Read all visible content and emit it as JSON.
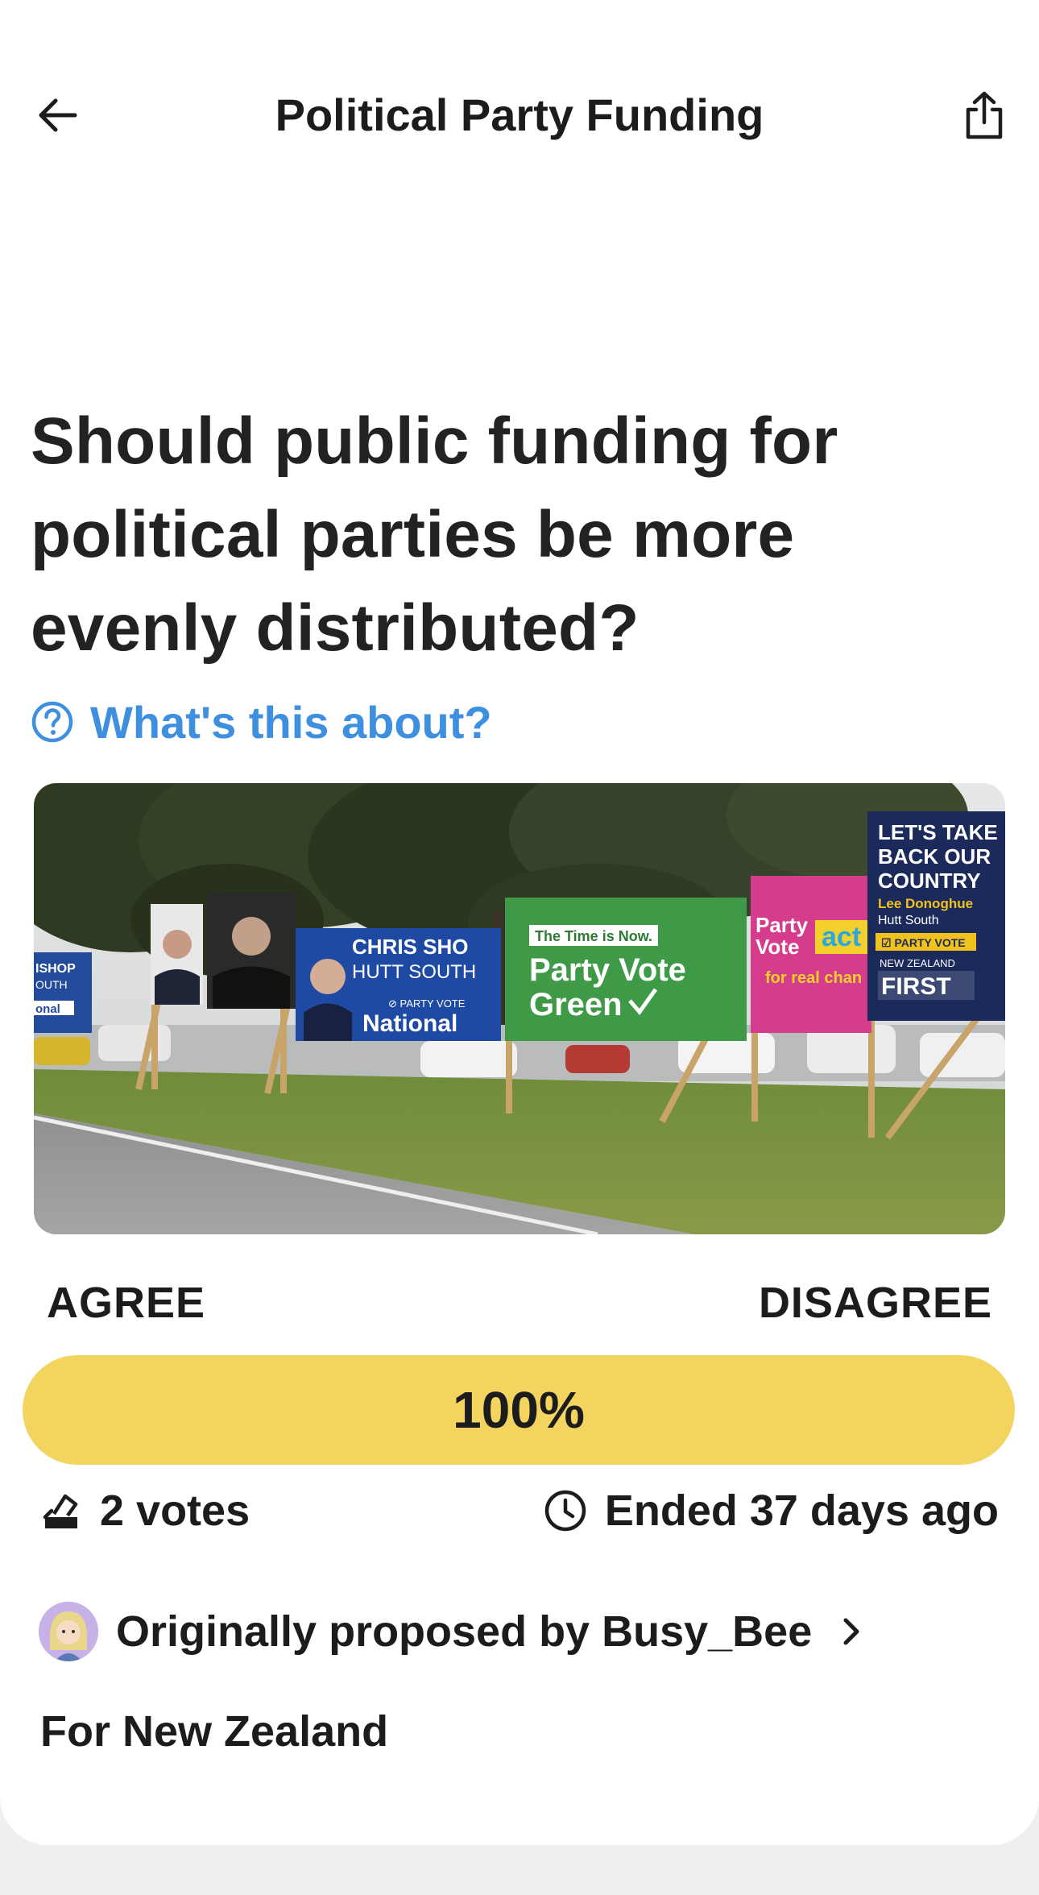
{
  "header": {
    "title": "Political Party Funding",
    "back_icon": "arrow-left-icon",
    "share_icon": "share-icon"
  },
  "question": {
    "text": "Should public funding for political parties be more evenly distributed?",
    "about_link": "What's this about?",
    "about_icon": "question-circle-icon"
  },
  "photo": {
    "description_icon": "election-billboards-photo",
    "sign_texts": {
      "lets_take": "LET'S TAKE",
      "back_our": "BACK OUR",
      "country": "COUNTRY",
      "candidate": "Lee Donoghue",
      "electorate": "Hutt South",
      "party_vote": "☑ PARTY VOTE",
      "nz_first": "NEW ZEALAND",
      "first": "FIRST",
      "green_top": "The Time is Now.",
      "green_main1": "Party Vote",
      "green_main2": "Green",
      "act_1": "Party",
      "act_2": "Vote",
      "act_logo": "act",
      "act_sub": "for real chan",
      "nat_top": "CHRIS   SHO",
      "nat_sub": "HUTT SOUTH",
      "nat_pv": "⊘ PARTY VOTE",
      "nat_main": "National",
      "left_1": "ISHOP",
      "left_2": "OUTH",
      "left_3": "onal"
    }
  },
  "vote": {
    "agree_label": "AGREE",
    "disagree_label": "DISAGREE",
    "agree_percent": 100,
    "bar_text": "100%",
    "colors": {
      "agree": "#f2d45e",
      "track": "#eeeeee"
    }
  },
  "stats": {
    "votes_icon": "ballot-box-icon",
    "votes_text": "2 votes",
    "ended_icon": "clock-icon",
    "ended_text": "Ended 37 days ago"
  },
  "proposer": {
    "text": "Originally proposed by Busy_Bee",
    "avatar_icon": "avatar",
    "chevron_icon": "chevron-right-icon"
  },
  "region": {
    "text": "For New Zealand"
  },
  "colors": {
    "link": "#3f8fe0",
    "background": "#f1efed"
  }
}
